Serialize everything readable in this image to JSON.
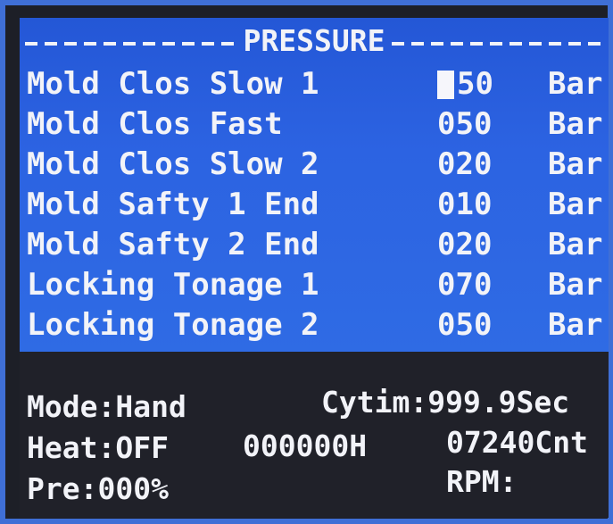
{
  "screen": {
    "title": "PRESSURE",
    "rows": [
      {
        "label": "Mold Clos Slow 1",
        "value": "50",
        "unit": "Bar"
      },
      {
        "label": "Mold Clos Fast",
        "value": "050",
        "unit": "Bar"
      },
      {
        "label": "Mold Clos Slow 2",
        "value": "020",
        "unit": "Bar"
      },
      {
        "label": "Mold Safty 1 End",
        "value": "010",
        "unit": "Bar"
      },
      {
        "label": "Mold Safty 2 End",
        "value": "020",
        "unit": "Bar"
      },
      {
        "label": "Locking Tonage 1",
        "value": "070",
        "unit": "Bar"
      },
      {
        "label": "Locking Tonage 2",
        "value": "050",
        "unit": "Bar"
      }
    ]
  },
  "status": {
    "mode": "Mode:Hand",
    "cytim": "Cytim:999.9Sec",
    "heat": "Heat:OFF",
    "hours": "000000H",
    "count": "07240Cnt",
    "pre": "Pre:000%",
    "rpm": "RPM:"
  },
  "colors": {
    "screen_blue": "#2c63e2",
    "screen_dark": "#202129",
    "text": "#f2f3f8",
    "frame": "#3f6fd6"
  }
}
